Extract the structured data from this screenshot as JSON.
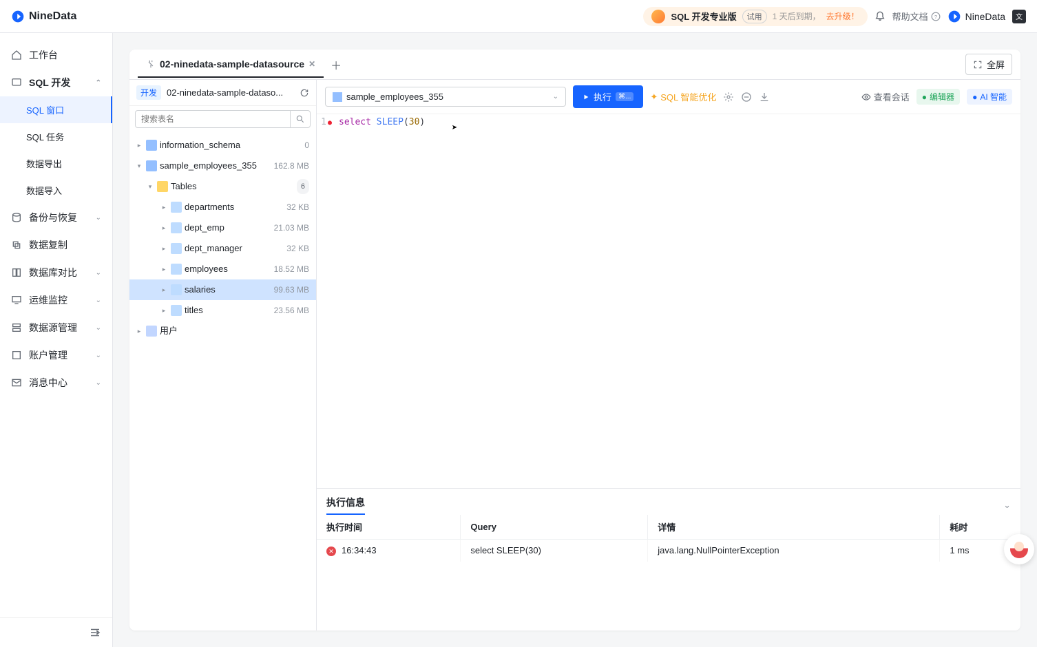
{
  "brand": "NineData",
  "topbar": {
    "edition": "SQL 开发专业版",
    "trial": "试用",
    "expire": "1 天后到期，",
    "upgrade": "去升级！",
    "help": "帮助文档",
    "org": "NineData"
  },
  "sidebar": {
    "workbench": "工作台",
    "sqlDev": "SQL 开发",
    "sqlWindow": "SQL 窗口",
    "sqlTask": "SQL 任务",
    "dataExport": "数据导出",
    "dataImport": "数据导入",
    "backup": "备份与恢复",
    "replication": "数据复制",
    "compare": "数据库对比",
    "ops": "运维监控",
    "datasource": "数据源管理",
    "account": "账户管理",
    "message": "消息中心"
  },
  "tabs": {
    "active": "02-ninedata-sample-datasource",
    "fullscreen": "全屏"
  },
  "treeHead": {
    "env": "开发",
    "ds": "02-ninedata-sample-dataso..."
  },
  "search": {
    "placeholder": "搜索表名"
  },
  "tree": {
    "db1": {
      "name": "information_schema",
      "meta": "0"
    },
    "db2": {
      "name": "sample_employees_355",
      "meta": "162.8 MB"
    },
    "tablesLabel": "Tables",
    "tablesCount": "6",
    "tables": [
      {
        "name": "departments",
        "size": "32 KB"
      },
      {
        "name": "dept_emp",
        "size": "21.03 MB"
      },
      {
        "name": "dept_manager",
        "size": "32 KB"
      },
      {
        "name": "employees",
        "size": "18.52 MB"
      },
      {
        "name": "salaries",
        "size": "99.63 MB"
      },
      {
        "name": "titles",
        "size": "23.56 MB"
      }
    ],
    "users": "用户"
  },
  "toolbar": {
    "dbSelect": "sample_employees_355",
    "run": "执行",
    "runKbd": "⌘...",
    "optimize": "SQL 智能优化",
    "viewSession": "查看会话",
    "editor": "编辑器",
    "ai": "AI 智能"
  },
  "code": {
    "lineNo": "1",
    "kwSelect": "select",
    "fn": "SLEEP",
    "lp": "(",
    "num": "30",
    "rp": ")"
  },
  "results": {
    "title": "执行信息",
    "cols": {
      "time": "执行时间",
      "query": "Query",
      "detail": "详情",
      "elapsed": "耗时"
    },
    "row": {
      "time": "16:34:43",
      "query": "select SLEEP(30)",
      "detail": "java.lang.NullPointerException",
      "elapsed": "1 ms"
    }
  }
}
